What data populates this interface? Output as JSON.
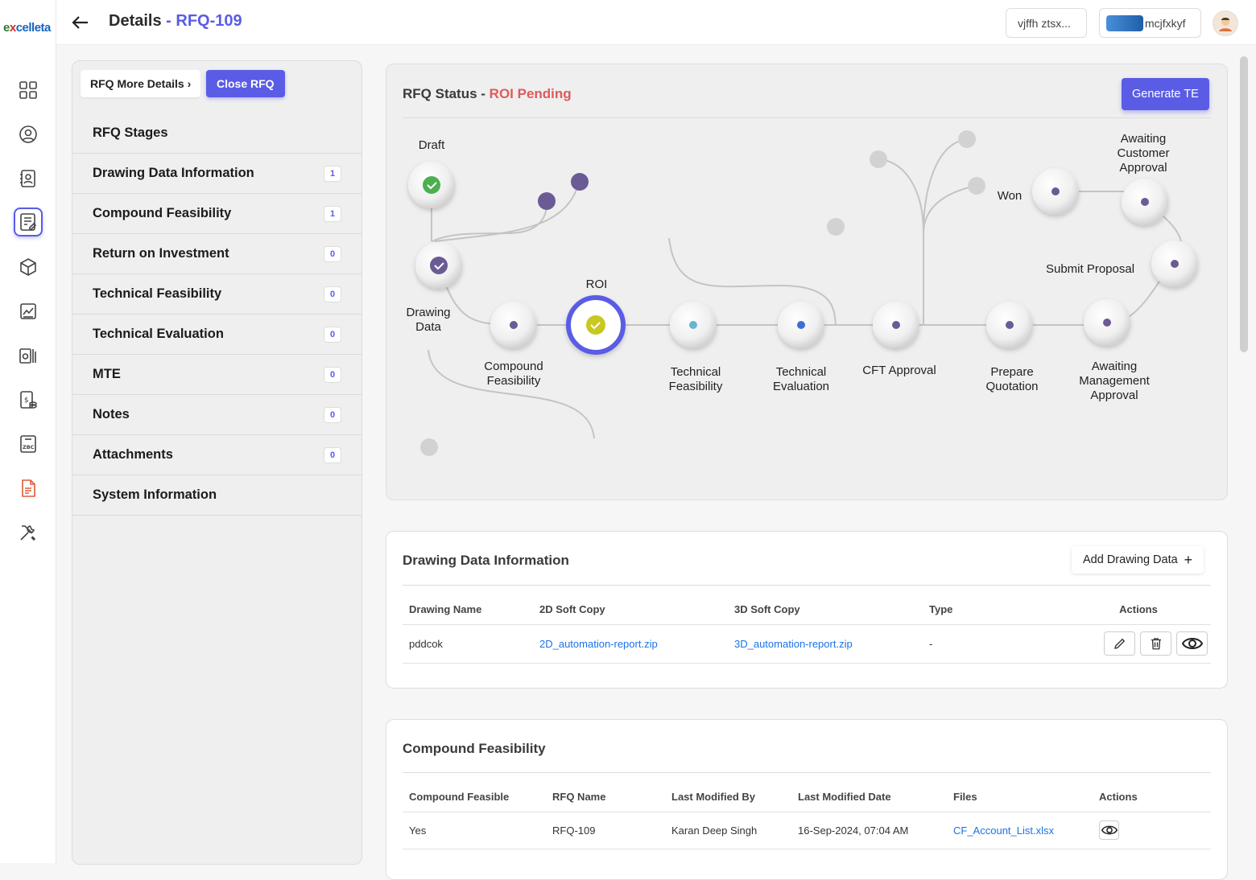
{
  "logo": {
    "part1": "e",
    "part2": "x",
    "part3": "celleta"
  },
  "nav_icons": [
    "dashboard-icon",
    "user-circle-icon",
    "contact-card-icon",
    "rfq-doc-icon",
    "cube-icon",
    "chart-icon",
    "printer-tools-icon",
    "invoice-icon",
    "zbc-icon",
    "pdf-doc-icon",
    "tools-icon"
  ],
  "header": {
    "title": "Details",
    "dash": " - ",
    "rfq_id": "RFQ-109",
    "chip1": "vjffh ztsx...",
    "chip2": "mcjfxkyf"
  },
  "left": {
    "more_details": "RFQ More Details",
    "chevron": "›",
    "close_rfq": "Close RFQ",
    "stages": [
      {
        "label": "RFQ Stages",
        "count": null
      },
      {
        "label": "Drawing Data Information",
        "count": "1"
      },
      {
        "label": "Compound Feasibility",
        "count": "1"
      },
      {
        "label": "Return on Investment",
        "count": "0"
      },
      {
        "label": "Technical Feasibility",
        "count": "0"
      },
      {
        "label": "Technical Evaluation",
        "count": "0"
      },
      {
        "label": "MTE",
        "count": "0"
      },
      {
        "label": "Notes",
        "count": "0"
      },
      {
        "label": "Attachments",
        "count": "0"
      },
      {
        "label": "System Information",
        "count": null
      }
    ]
  },
  "status": {
    "label": "RFQ Status - ",
    "value": "ROI Pending",
    "generate": "Generate TE",
    "nodes": {
      "draft": "Draft",
      "drawing1": "Drawing",
      "drawing2": "Data",
      "compound1": "Compound",
      "compound2": "Feasibility",
      "roi": "ROI",
      "tech_f1": "Technical",
      "tech_f2": "Feasibility",
      "tech_e1": "Technical",
      "tech_e2": "Evaluation",
      "cft": "CFT Approval",
      "prep1": "Prepare",
      "prep2": "Quotation",
      "amgmt1": "Awaiting",
      "amgmt2": "Management",
      "amgmt3": "Approval",
      "submit": "Submit Proposal",
      "won": "Won",
      "acust1": "Awaiting",
      "acust2": "Customer",
      "acust3": "Approval"
    }
  },
  "drawing": {
    "title": "Drawing Data Information",
    "add": "Add Drawing Data",
    "plus": "+",
    "headers": [
      "Drawing Name",
      "2D Soft Copy",
      "3D Soft Copy",
      "Type",
      "Actions"
    ],
    "rows": [
      {
        "name": "pddcok",
        "d2": "2D_automation-report.zip",
        "d3": "3D_automation-report.zip",
        "type": "-"
      }
    ]
  },
  "compound": {
    "title": "Compound Feasibility",
    "headers": [
      "Compound Feasible",
      "RFQ Name",
      "Last Modified By",
      "Last Modified Date",
      "Files",
      "Actions"
    ],
    "rows": [
      {
        "feasible": "Yes",
        "rfq": "RFQ-109",
        "by": "Karan Deep Singh",
        "date": "16-Sep-2024, 07:04 AM",
        "file": "CF_Account_List.xlsx"
      }
    ]
  },
  "colors": {
    "accent": "#5a5ce6",
    "pending": "#e05a5a",
    "done": "#4caf50",
    "roi": "#c8c820",
    "node_dot": "#6b5b95"
  }
}
